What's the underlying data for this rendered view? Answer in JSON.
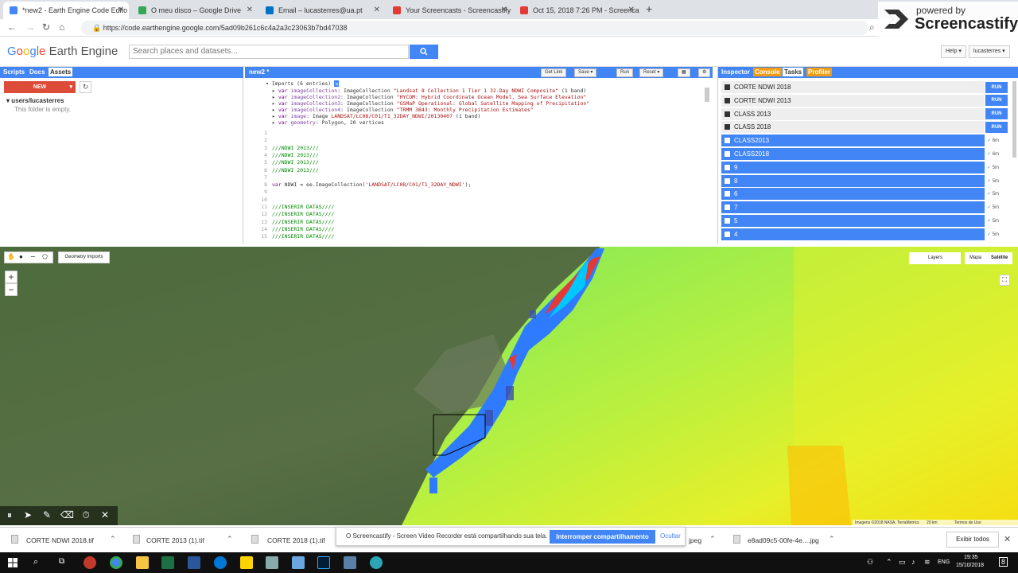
{
  "browser": {
    "tabs": [
      {
        "title": "*new2 - Earth Engine Code Edito",
        "color": "#4285f4"
      },
      {
        "title": "O meu disco – Google Drive",
        "color": "#34a853"
      },
      {
        "title": "Email – lucasterres@ua.pt",
        "color": "#0072c6"
      },
      {
        "title": "Your Screencasts - Screencastify",
        "color": "#e53935"
      },
      {
        "title": "Oct 15, 2018 7:26 PM - Screenca",
        "color": "#e53935"
      }
    ],
    "url": "https://code.earthengine.google.com/5ad09b261c6c4a2a3c23063b7bd47038",
    "newtab": "+"
  },
  "screencastify": {
    "powered_by": "powered by",
    "brand": "Screencastify"
  },
  "header": {
    "logo_google": [
      "G",
      "o",
      "o",
      "g",
      "l",
      "e"
    ],
    "logo_rest": "Earth Engine",
    "search_placeholder": "Search places and datasets...",
    "help": "Help",
    "user": "lucasterres"
  },
  "left_panel": {
    "tabs": [
      "Scripts",
      "Docs",
      "Assets"
    ],
    "new_label": "NEW",
    "user_folder": "users/lucasterres",
    "empty_text": "This folder is empty."
  },
  "editor": {
    "title": "new2 *",
    "buttons": [
      "Get Link",
      "Save",
      "Run",
      "Reset"
    ],
    "imports_header": "Imports (6 entries)",
    "imports": [
      {
        "kw": "var",
        "name": "imageCollection",
        "rest": ": ImageCollection ",
        "str": "\"Landsat 8 Collection 1 Tier 1 32-Day NDWI Composite\"",
        "tail": " (1 band)"
      },
      {
        "kw": "var",
        "name": "imageCollection2",
        "rest": ": ImageCollection ",
        "str": "\"HYCOM: Hybrid Coordinate Ocean Model, Sea Surface Elevation\"",
        "tail": ""
      },
      {
        "kw": "var",
        "name": "imageCollection3",
        "rest": ": ImageCollection ",
        "str": "\"GSMaP Operational: Global Satellite Mapping of Precipitation\"",
        "tail": ""
      },
      {
        "kw": "var",
        "name": "imageCollection4",
        "rest": ": ImageCollection ",
        "str": "\"TRMM 3B43: Monthly Precipitation Estimates\"",
        "tail": ""
      },
      {
        "kw": "var",
        "name": "image",
        "rest": ": Image ",
        "str": "LANDSAT/LC08/C01/T1_32DAY_NDWI/20130407",
        "tail": " (1 band)"
      },
      {
        "kw": "var",
        "name": "geometry",
        "rest": ": Polygon, 20 vertices",
        "str": "",
        "tail": ""
      }
    ],
    "lines": [
      {
        "n": "1",
        "t": "",
        "c": "cl"
      },
      {
        "n": "2",
        "t": "",
        "c": "cl"
      },
      {
        "n": "3",
        "t": "///NDWI 2013///",
        "c": "cm"
      },
      {
        "n": "4",
        "t": "///NDWI 2013///",
        "c": "cm"
      },
      {
        "n": "5",
        "t": "///NDWI 2013///",
        "c": "cm"
      },
      {
        "n": "6",
        "t": "///NDWI 2013///",
        "c": "cm"
      },
      {
        "n": "7",
        "t": "",
        "c": "cl"
      },
      {
        "n": "8",
        "t": "var NDWI = ee.ImageCollection('LANDSAT/LC08/C01/T1_32DAY_NDWI');",
        "c": "code"
      },
      {
        "n": "9",
        "t": "",
        "c": "cl"
      },
      {
        "n": "10",
        "t": "",
        "c": "cl"
      },
      {
        "n": "11",
        "t": "///INSERIR DATAS////",
        "c": "cm"
      },
      {
        "n": "12",
        "t": "///INSERIR DATAS////",
        "c": "cm"
      },
      {
        "n": "13",
        "t": "///INSERIR DATAS////",
        "c": "cm"
      },
      {
        "n": "14",
        "t": "///INSERIR DATAS////",
        "c": "cm"
      },
      {
        "n": "15",
        "t": "///INSERIR DATAS////",
        "c": "cm"
      }
    ]
  },
  "right_panel": {
    "tabs": [
      "Inspector",
      "Console",
      "Tasks",
      "Profiler"
    ],
    "run_label": "RUN",
    "todo_tasks": [
      "CORTE NDWI 2018",
      "CORTE NDWI 2013",
      "CLASS 2013",
      "CLASS 2018"
    ],
    "done_tasks": [
      {
        "name": "CLASS2013",
        "time": "6m"
      },
      {
        "name": "CLASS2018",
        "time": "6m"
      },
      {
        "name": "9",
        "time": "5m"
      },
      {
        "name": "8",
        "time": "5m"
      },
      {
        "name": "6",
        "time": "5m"
      },
      {
        "name": "7",
        "time": "5m"
      },
      {
        "name": "5",
        "time": "5m"
      },
      {
        "name": "4",
        "time": "5m"
      }
    ]
  },
  "map": {
    "geometry_imports": "Geometry Imports",
    "zoom_in": "+",
    "zoom_out": "−",
    "layers": "Layers",
    "map_label": "Mapa",
    "satellite_label": "Satélite",
    "attribution": "Imagens ©2018 NASA, TerraMetrics",
    "scale": "20 km",
    "terms": "Termos de Uso"
  },
  "recorder": {
    "icons": [
      "pause-icon",
      "pointer-icon",
      "pen-icon",
      "eraser-icon",
      "timer-icon",
      "close-icon"
    ]
  },
  "share_banner": {
    "text": "O Screencastify - Screen Video Recorder está compartilhando sua tela.",
    "stop": "Interromper compartilhamento",
    "hide": "Ocultar"
  },
  "downloads": {
    "items": [
      "CORTE NDWI 2018.tif",
      "CORTE 2013 (1).tif",
      "CORTE 2018 (1).tif",
      "jpeg",
      "e8ad09c5-00fe-4e....jpg"
    ],
    "show_all": "Exibir todos"
  },
  "taskbar": {
    "lang": "ENG",
    "time": "19:35",
    "date": "15/10/2018",
    "notif": "8"
  }
}
